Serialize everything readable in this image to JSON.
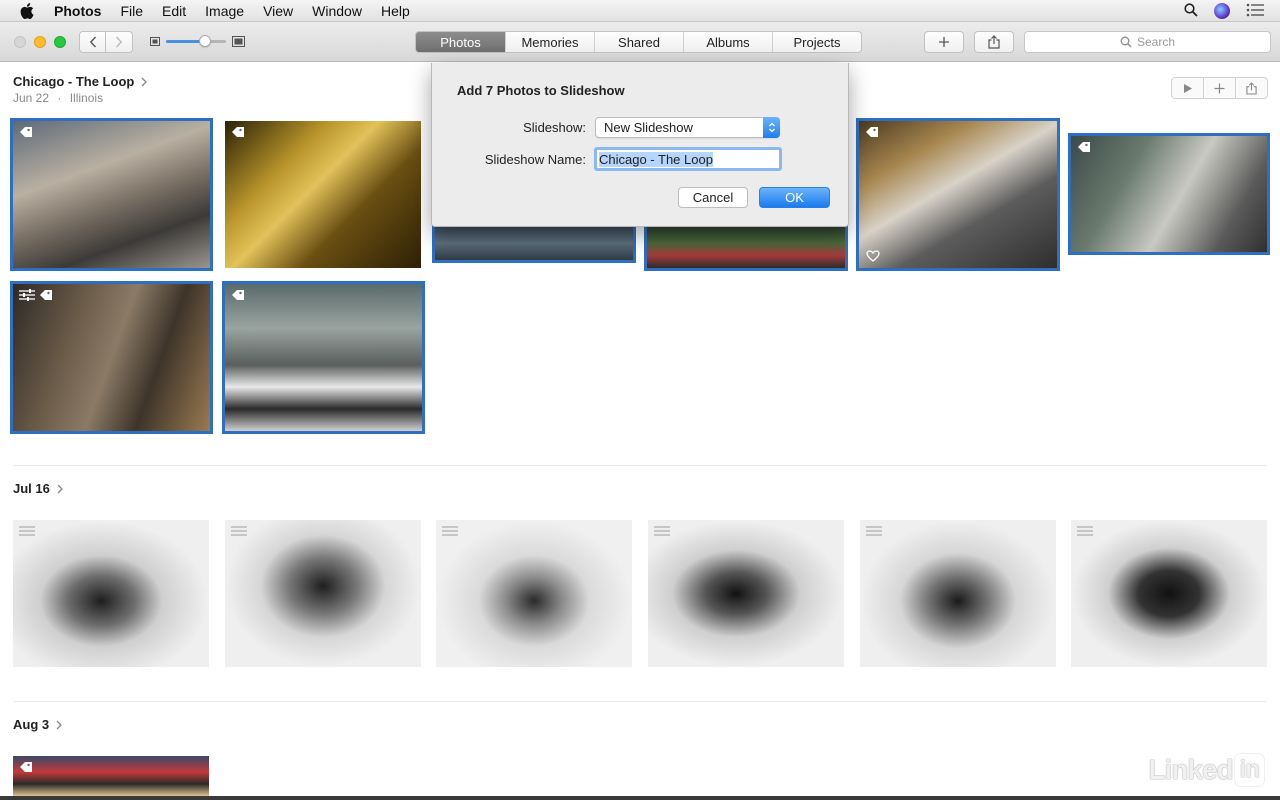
{
  "menubar": {
    "app_name": "Photos",
    "items": [
      "File",
      "Edit",
      "Image",
      "View",
      "Window",
      "Help"
    ]
  },
  "toolbar": {
    "zoom_level": 0.65,
    "tabs": [
      {
        "label": "Photos",
        "active": true
      },
      {
        "label": "Memories",
        "active": false
      },
      {
        "label": "Shared",
        "active": false
      },
      {
        "label": "Albums",
        "active": false
      },
      {
        "label": "Projects",
        "active": false
      }
    ],
    "search_placeholder": "Search",
    "accent_color": "#2f6fc0"
  },
  "sections": [
    {
      "title": "Chicago - The Loop",
      "date": "Jun 22",
      "location": "Illinois",
      "photo_count": 8,
      "selected_count": 7
    },
    {
      "title": "Jul 16",
      "photo_count": 6
    },
    {
      "title": "Aug 3",
      "photo_count": 1
    }
  ],
  "dialog": {
    "title": "Add 7 Photos to Slideshow",
    "slideshow_label": "Slideshow:",
    "slideshow_value": "New Slideshow",
    "name_label": "Slideshow Name:",
    "name_value": "Chicago - The Loop",
    "cancel_label": "Cancel",
    "ok_label": "OK"
  },
  "watermark": {
    "text": "Linked",
    "badge": "in"
  }
}
